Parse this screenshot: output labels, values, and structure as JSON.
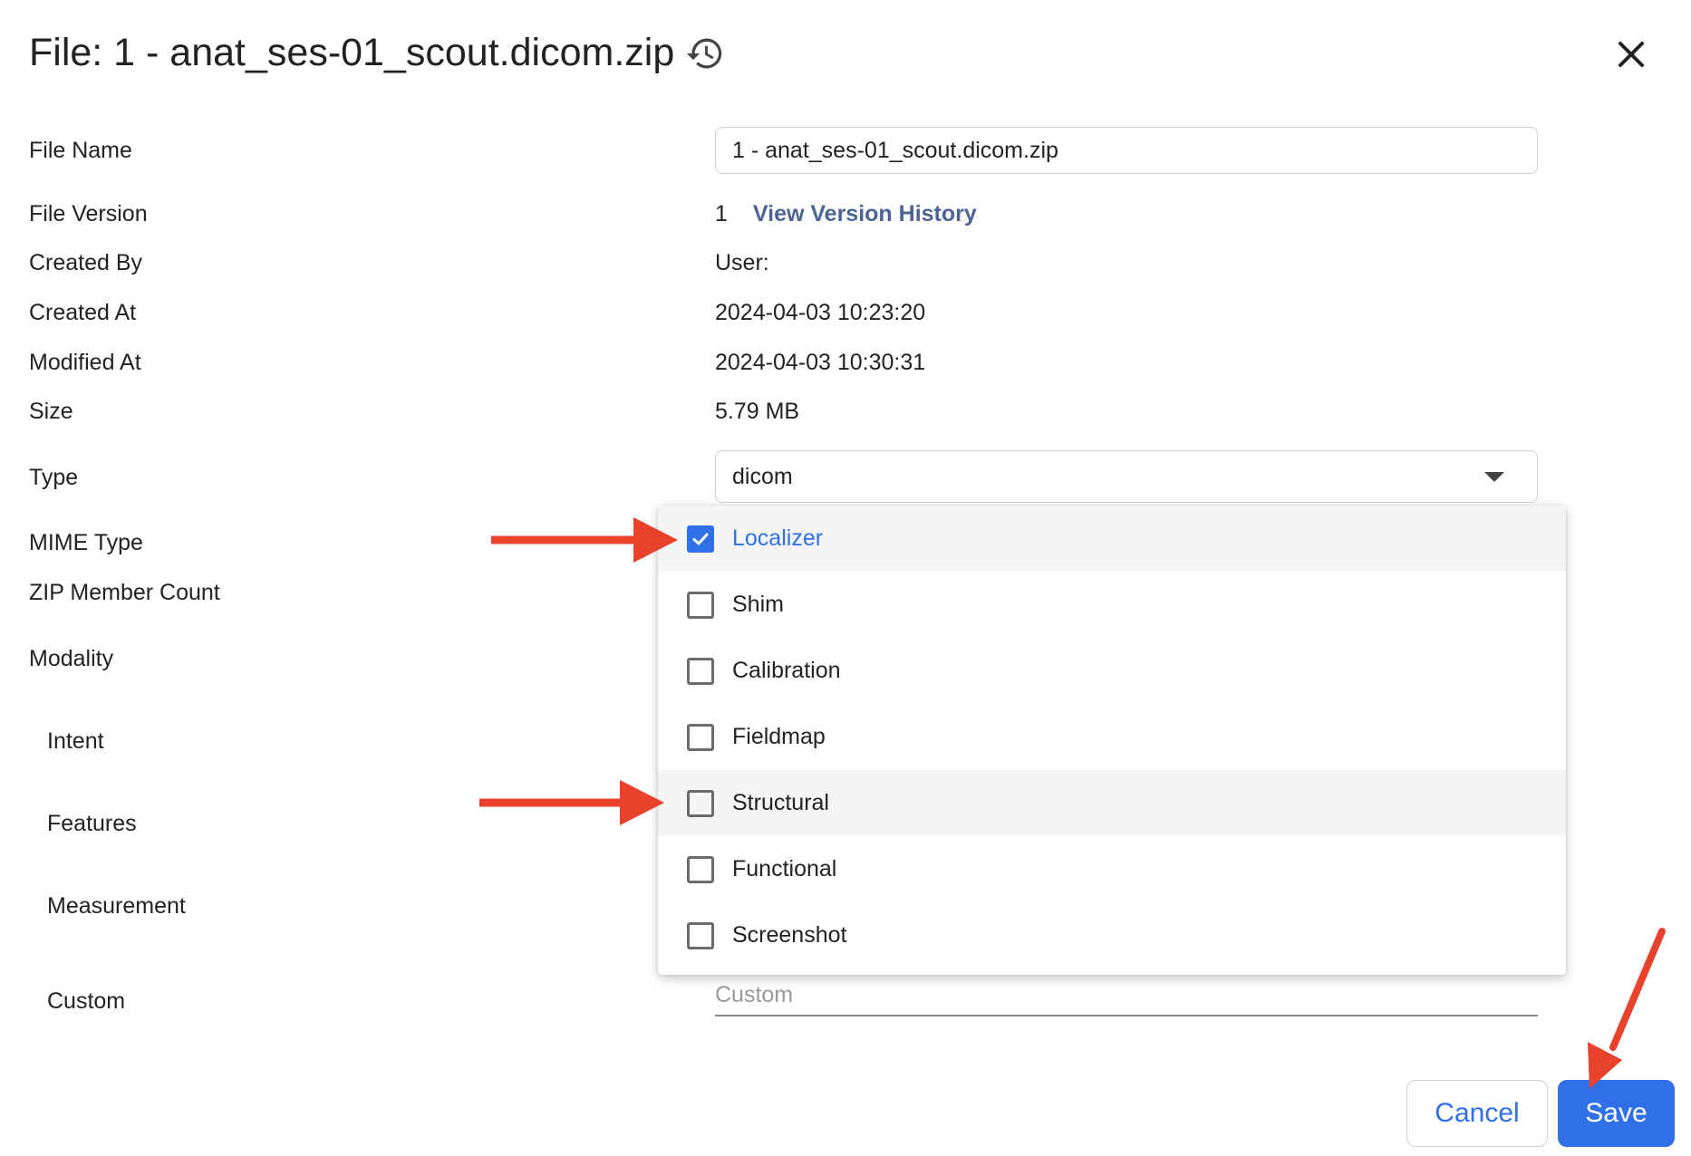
{
  "dialog": {
    "title": "File: 1 - anat_ses-01_scout.dicom.zip",
    "icons": {
      "history": "history-icon",
      "close": "close-icon"
    }
  },
  "fields": {
    "file_name": {
      "label": "File Name",
      "value": "1 - anat_ses-01_scout.dicom.zip"
    },
    "file_version": {
      "label": "File Version",
      "value": "1",
      "link": "View Version History"
    },
    "created_by": {
      "label": "Created By",
      "value": "User:"
    },
    "created_at": {
      "label": "Created At",
      "value": "2024-04-03 10:23:20"
    },
    "modified_at": {
      "label": "Modified At",
      "value": "2024-04-03 10:30:31"
    },
    "size": {
      "label": "Size",
      "value": "5.79 MB"
    },
    "type": {
      "label": "Type",
      "value": "dicom"
    },
    "mime_type": {
      "label": "MIME Type"
    },
    "zip_member_count": {
      "label": "ZIP Member Count"
    },
    "modality": {
      "label": "Modality"
    },
    "intent": {
      "label": "Intent"
    },
    "features": {
      "label": "Features"
    },
    "measurement": {
      "label": "Measurement"
    },
    "custom": {
      "label": "Custom",
      "placeholder": "Custom"
    }
  },
  "intent_dropdown": {
    "options": [
      {
        "label": "Localizer",
        "checked": true
      },
      {
        "label": "Shim",
        "checked": false
      },
      {
        "label": "Calibration",
        "checked": false
      },
      {
        "label": "Fieldmap",
        "checked": false
      },
      {
        "label": "Structural",
        "checked": false
      },
      {
        "label": "Functional",
        "checked": false
      },
      {
        "label": "Screenshot",
        "checked": false
      }
    ]
  },
  "footer": {
    "cancel_label": "Cancel",
    "save_label": "Save"
  },
  "colors": {
    "primary": "#2f6fe8",
    "link": "#4c6393",
    "annotation_arrow": "#e8412c"
  }
}
